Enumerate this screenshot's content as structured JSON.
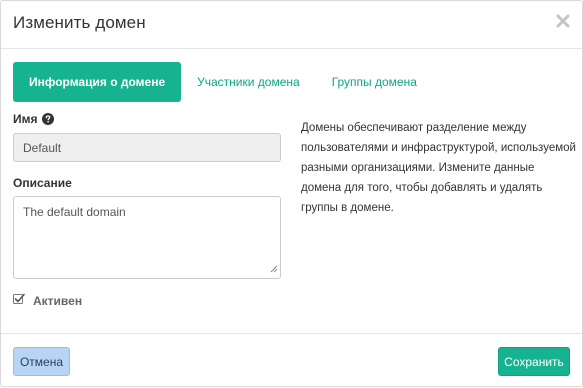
{
  "dialog": {
    "title": "Изменить домен",
    "close_icon": "close-icon"
  },
  "tabs": [
    {
      "label": "Информация о домене",
      "active": true
    },
    {
      "label": "Участники домена",
      "active": false
    },
    {
      "label": "Группы домена",
      "active": false
    }
  ],
  "form": {
    "name_label": "Имя",
    "name_value": "Default",
    "description_label": "Описание",
    "description_value": "The default domain",
    "enabled_label": "Активен",
    "enabled_checked": true
  },
  "help_text": "Домены обеспечивают разделение между пользователями и инфраструктурой, используемой разными организациями. Измените данные домена для того, чтобы добавлять и удалять группы в домене.",
  "footer": {
    "cancel_label": "Отмена",
    "save_label": "Сохранить"
  },
  "colors": {
    "accent": "#16b391",
    "tab_link": "#0aa788",
    "cancel_bg": "#b8d4f5"
  }
}
